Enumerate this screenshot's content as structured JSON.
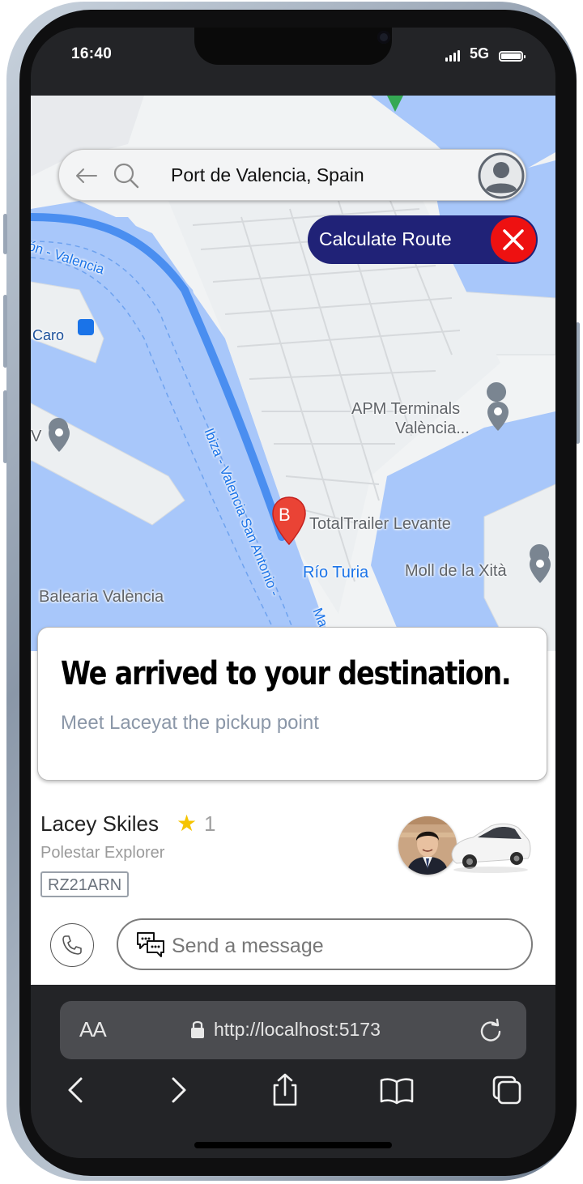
{
  "status_bar": {
    "time": "16:40",
    "network": "5G"
  },
  "search": {
    "value": "Port de Valencia, Spain"
  },
  "route_button": {
    "label": "Calculate Route"
  },
  "map": {
    "labels": {
      "route_top": "ón - Valencia",
      "caro": "Caro",
      "apm_line1": "APM Terminals",
      "apm_line2": "València...",
      "v": "V",
      "total_trailer": "TotalTrailer Levante",
      "rio_turia": "Río Turia",
      "moll": "Moll de la Xità",
      "balearia": "Balearia València",
      "route_diag": "Ibiza - Valencia San Antonio -",
      "ma": "Ma"
    },
    "marker_letter": "B",
    "colors": {
      "water": "#a8c7fa",
      "land": "#f1f3f4",
      "route": "#4a8ef0",
      "marker": "#ea4335"
    }
  },
  "arrival": {
    "title": "We arrived to your destination.",
    "subtitle": "Meet Laceyat the pickup point"
  },
  "driver": {
    "name": "Lacey Skiles",
    "rating": "1",
    "car": "Polestar Explorer",
    "plate": "RZ21ARN"
  },
  "message": {
    "placeholder": "Send a message"
  },
  "browser": {
    "aa": "AA",
    "url": "http://localhost:5173"
  },
  "icons": [
    "back-arrow-icon",
    "search-icon",
    "profile-icon",
    "close-icon",
    "lock-icon",
    "reload-icon",
    "phone-icon",
    "chat-icon",
    "nav-back-icon",
    "nav-forward-icon",
    "share-icon",
    "bookmarks-icon",
    "tabs-icon"
  ]
}
